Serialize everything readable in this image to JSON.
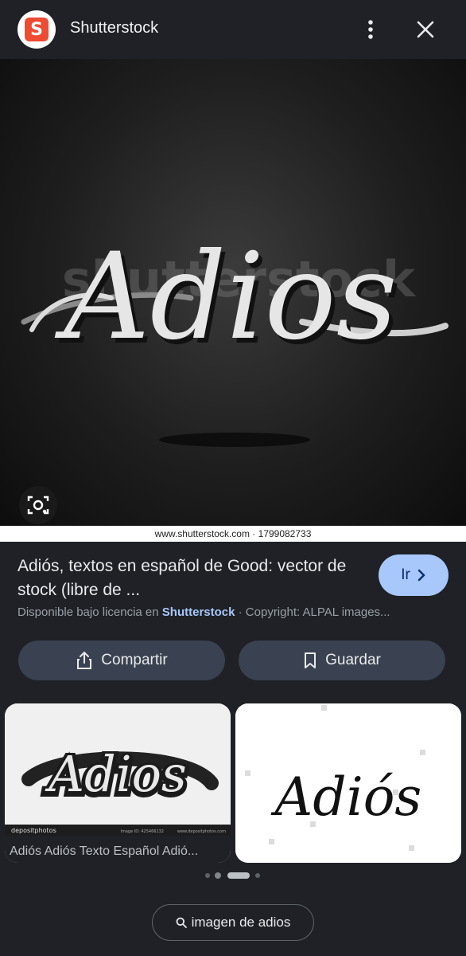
{
  "header": {
    "site_name": "Shutterstock",
    "logo_glyph": "S",
    "menu_icon": "more-vert-icon",
    "close_icon": "close-icon"
  },
  "main_image": {
    "lettering": "Adios",
    "watermark": "shutterstock",
    "credit_line": "www.shutterstock.com · 1799082733",
    "lens_icon": "lens-camera-icon"
  },
  "result": {
    "title": "Adiós, textos en español de Good: vector de stock (libre de ...",
    "go_label": "Ir",
    "license_prefix": "Disponible bajo licencia en ",
    "license_source": "Shutterstock",
    "license_suffix": " · Copyright: ALPAL images..."
  },
  "actions": {
    "share_label": "Compartir",
    "save_label": "Guardar"
  },
  "related": [
    {
      "caption": "Adiós Adiós Texto Español Adió...",
      "image_text": "Adios",
      "footer_brand": "depositphotos",
      "footer_id": "Image ID: 425466132",
      "footer_url": "www.depositphotos.com"
    },
    {
      "image_text": "Adiós"
    }
  ],
  "pager": {
    "count": 4,
    "active_index": 2
  },
  "search": {
    "label": "imagen de adios"
  },
  "colors": {
    "background": "#1f2126",
    "accent": "#a8c7fa",
    "button": "#3a4150",
    "shutterstock_red": "#ef4a32"
  }
}
